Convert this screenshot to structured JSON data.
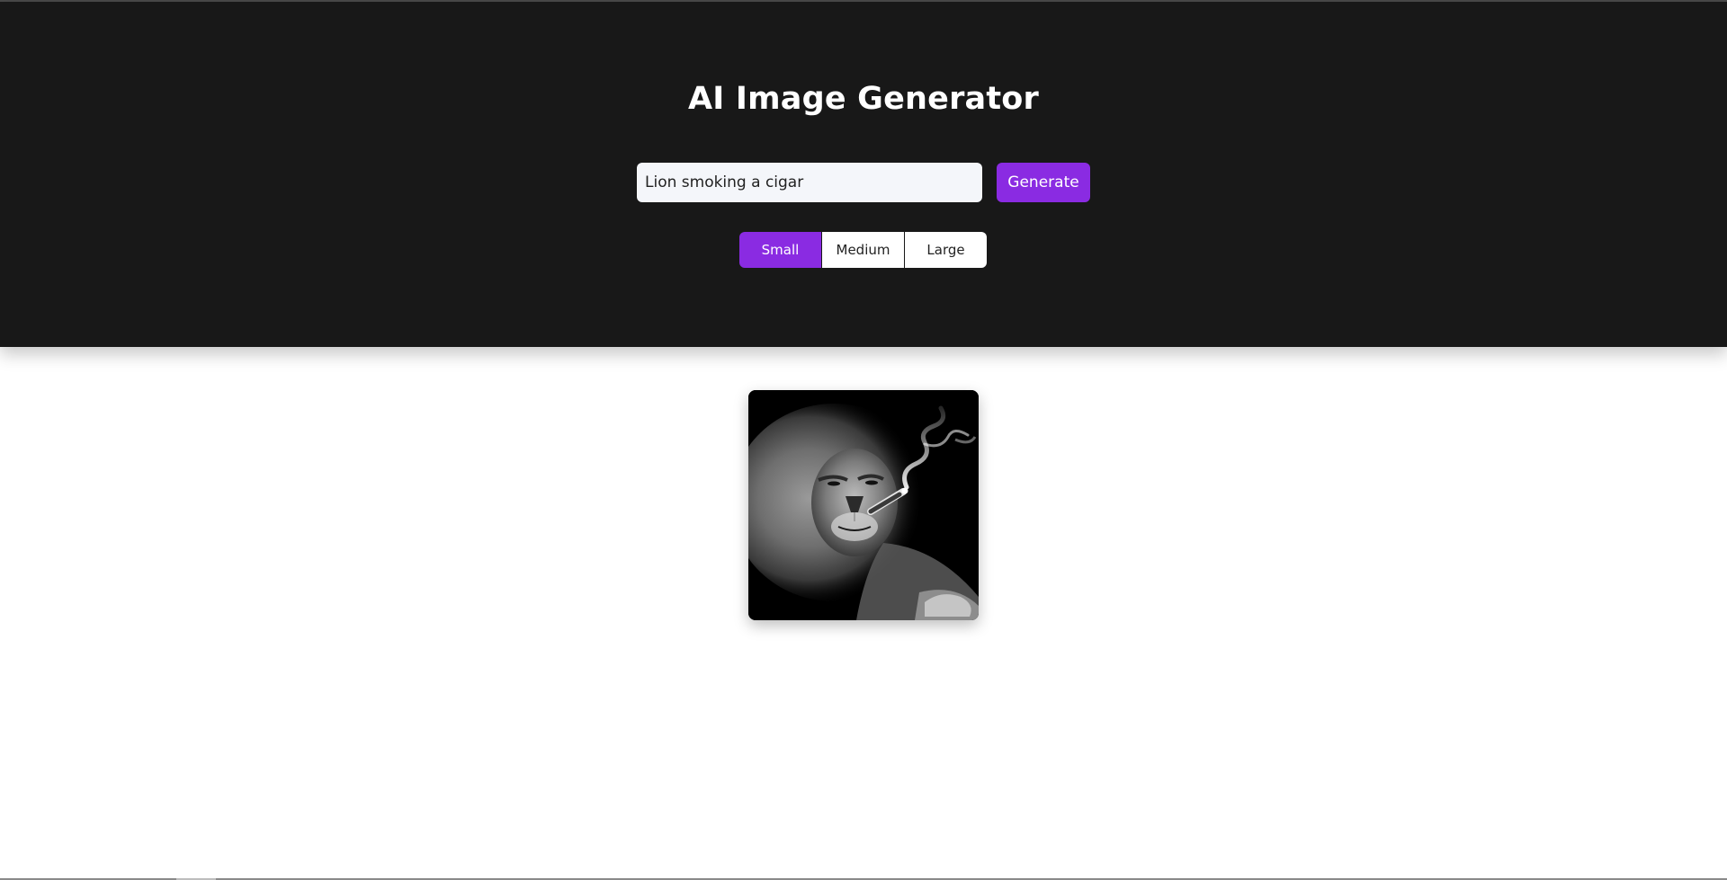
{
  "app": {
    "title": "AI Image Generator"
  },
  "prompt": {
    "value": "Lion smoking a cigar",
    "generate_label": "Generate"
  },
  "sizes": {
    "options": [
      "Small",
      "Medium",
      "Large"
    ],
    "selected": "Small"
  },
  "result": {
    "image_icon": "lion-smoking-cigar-photo",
    "alt": "Lion smoking a cigar"
  },
  "colors": {
    "header_bg": "#181818",
    "accent": "#8a2be2",
    "input_bg": "#f4f6fa",
    "page_bg": "#ffffff"
  }
}
